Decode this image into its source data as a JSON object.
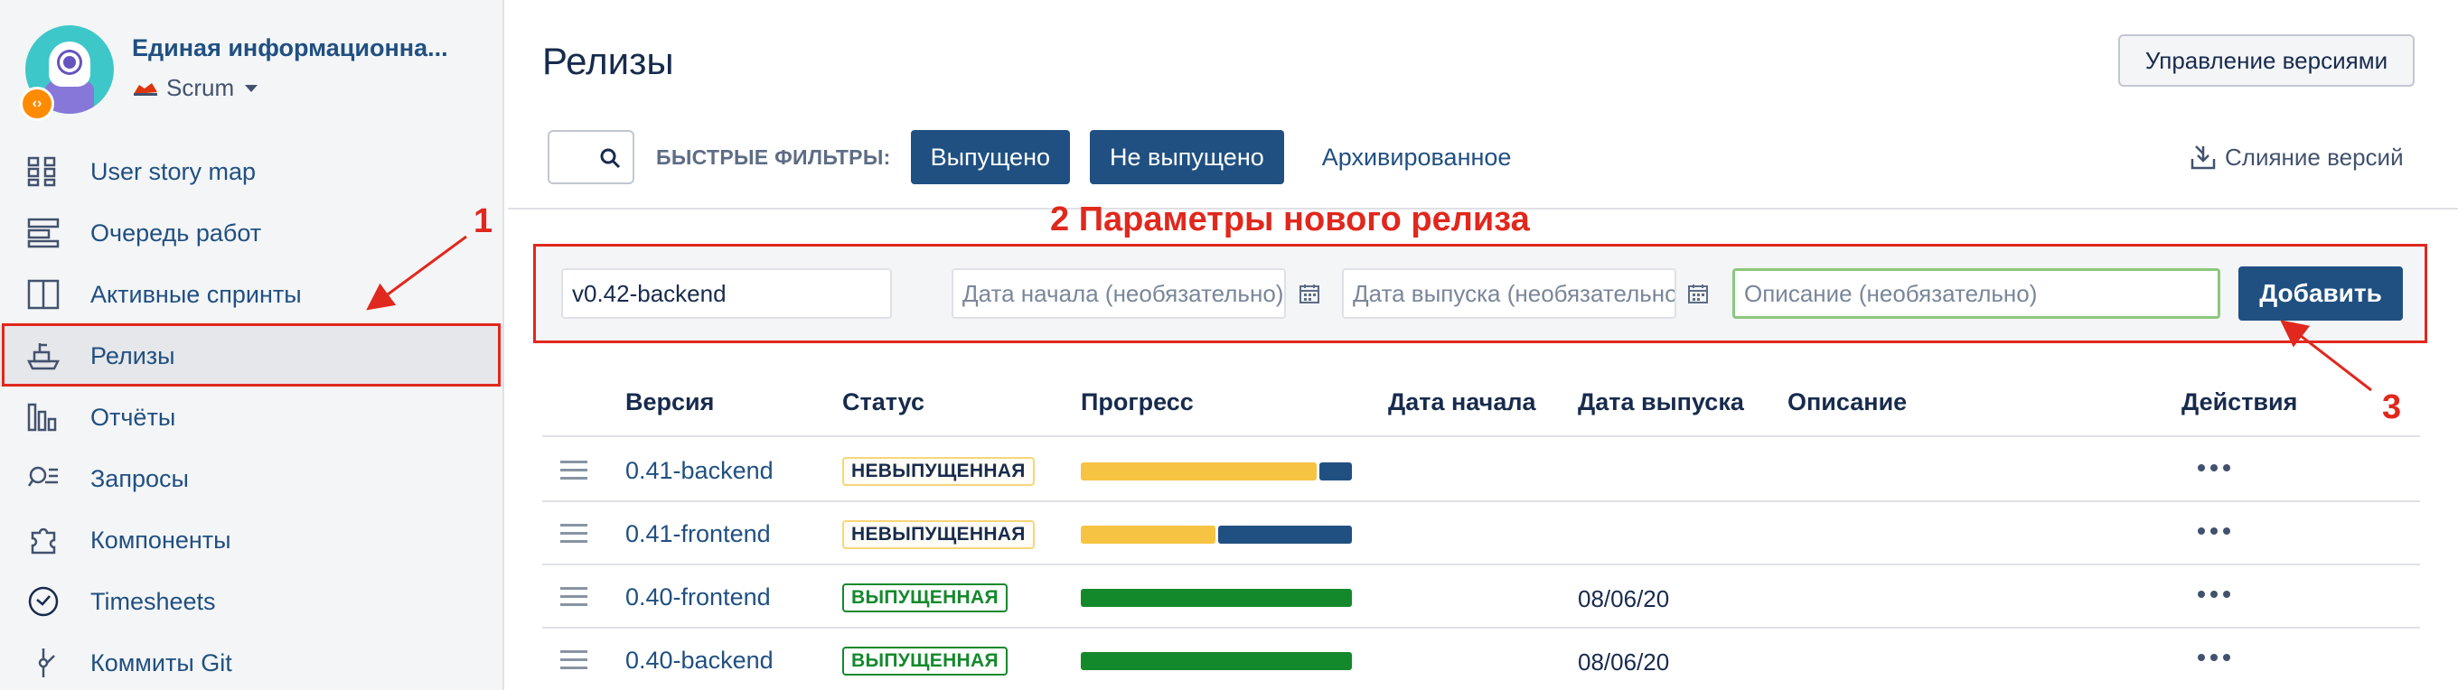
{
  "sidebar": {
    "project_name": "Единая информационна...",
    "board_name": "Scrum",
    "items": [
      {
        "label": "User story map",
        "icon": "story-map-icon"
      },
      {
        "label": "Очередь работ",
        "icon": "backlog-icon"
      },
      {
        "label": "Активные спринты",
        "icon": "sprint-board-icon"
      },
      {
        "label": "Релизы",
        "icon": "releases-ship-icon",
        "active": true
      },
      {
        "label": "Отчёты",
        "icon": "reports-chart-icon"
      },
      {
        "label": "Запросы",
        "icon": "issues-search-icon"
      },
      {
        "label": "Компоненты",
        "icon": "components-puzzle-icon"
      },
      {
        "label": "Timesheets",
        "icon": "clock-icon"
      },
      {
        "label": "Коммиты Git",
        "icon": "git-commit-icon"
      }
    ]
  },
  "header": {
    "title": "Релизы",
    "manage_versions_label": "Управление версиями"
  },
  "filters": {
    "quick_filters_label": "БЫСТРЫЕ ФИЛЬТРЫ:",
    "released_label": "Выпущено",
    "unreleased_label": "Не выпущено",
    "archived_label": "Архивированное",
    "merge_label": "Слияние версий"
  },
  "new_release": {
    "version_value": "v0.42-backend",
    "start_placeholder": "Дата начала (необязательно)",
    "release_placeholder": "Дата выпуска (необязательно)",
    "description_placeholder": "Описание (необязательно)",
    "add_label": "Добавить"
  },
  "table": {
    "headers": {
      "version": "Версия",
      "status": "Статус",
      "progress": "Прогресс",
      "start_date": "Дата начала",
      "release_date": "Дата выпуска",
      "description": "Описание",
      "actions": "Действия"
    },
    "rows": [
      {
        "version": "0.41-backend",
        "status": "НЕВЫПУЩЕННАЯ",
        "released": false,
        "progress": {
          "done": 0.88,
          "todo": 0.12
        },
        "start_date": "",
        "release_date": "",
        "description": ""
      },
      {
        "version": "0.41-frontend",
        "status": "НЕВЫПУЩЕННАЯ",
        "released": false,
        "progress": {
          "done": 0.5,
          "todo": 0.5
        },
        "start_date": "",
        "release_date": "",
        "description": ""
      },
      {
        "version": "0.40-frontend",
        "status": "ВЫПУЩЕННАЯ",
        "released": true,
        "progress": {
          "done": 1.0,
          "todo": 0
        },
        "start_date": "",
        "release_date": "08/06/20",
        "description": ""
      },
      {
        "version": "0.40-backend",
        "status": "ВЫПУЩЕННАЯ",
        "released": true,
        "progress": {
          "done": 1.0,
          "todo": 0
        },
        "start_date": "",
        "release_date": "08/06/20",
        "description": ""
      }
    ]
  },
  "annotations": {
    "one": "1",
    "two": "2 Параметры нового релиза",
    "three": "3"
  },
  "colors": {
    "accent": "#205081",
    "annotation": "#e0281e",
    "progress_yellow": "#f6c342",
    "progress_blue": "#205081",
    "progress_green": "#14892c"
  }
}
